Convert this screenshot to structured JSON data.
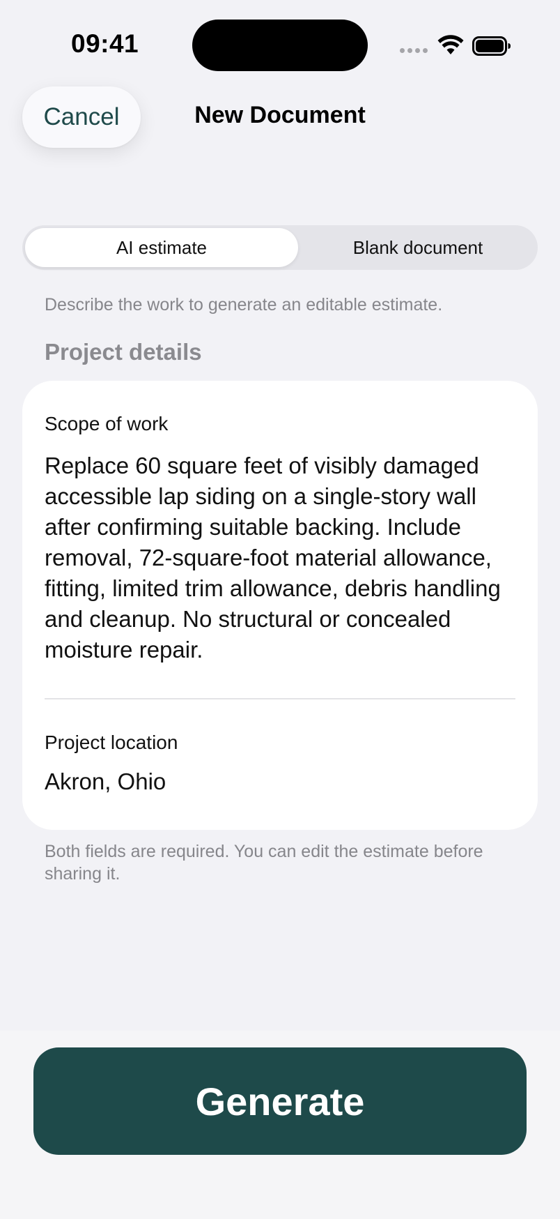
{
  "status_bar": {
    "time": "09:41",
    "icons": [
      "signal-dots-icon",
      "wifi-icon",
      "battery-icon"
    ]
  },
  "nav": {
    "cancel_label": "Cancel",
    "title": "New Document"
  },
  "mode_picker": {
    "options": [
      "AI estimate",
      "Blank document"
    ],
    "selected": "AI estimate"
  },
  "helper_text": "Describe the work to generate an editable estimate.",
  "section": {
    "title": "Project details"
  },
  "fields": {
    "scope": {
      "label": "Scope of work",
      "value": "Replace 60 square feet of visibly damaged accessible lap siding on a single-story wall after confirming suitable backing. Include removal, 72-square-foot material allowance, fitting, limited trim allowance, debris handling and cleanup. No structural or concealed moisture repair."
    },
    "location": {
      "label": "Project location",
      "value": "Akron, Ohio"
    }
  },
  "footnote": "Both fields are required. You can edit the estimate before sharing it.",
  "primary_action": {
    "label": "Generate"
  },
  "colors": {
    "accent": "#1e4a4a",
    "background": "#f2f2f6",
    "secondary_text": "#86868b"
  }
}
